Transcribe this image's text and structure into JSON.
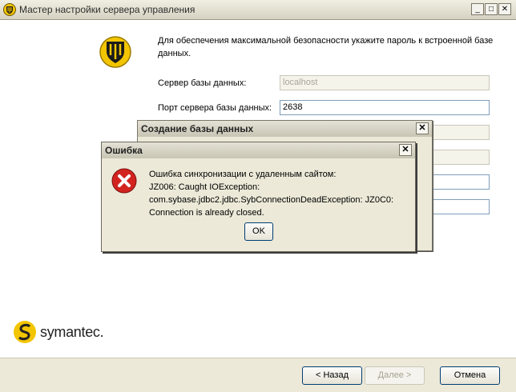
{
  "main_window": {
    "title": "Мастер настройки сервера управления",
    "controls": {
      "minimize": "_",
      "maximize": "□",
      "close": "✕"
    },
    "intro": "Для обеспечения максимальной безопасности укажите пароль к встроенной базе данных.",
    "fields": [
      {
        "label": "Сервер базы данных:",
        "value": "localhost",
        "disabled": true
      },
      {
        "label": "Порт сервера базы данных:",
        "value": "2638",
        "disabled": false
      }
    ],
    "brand": "symantec.",
    "buttons": {
      "back": "< Назад",
      "next": "Далее >",
      "cancel": "Отмена"
    }
  },
  "db_dialog": {
    "title": "Создание базы данных",
    "close": "✕"
  },
  "error_dialog": {
    "title": "Ошибка",
    "close": "✕",
    "message_lines": [
      "Ошибка синхронизации с удаленным сайтом:",
      "JZ006: Caught IOException:",
      "com.sybase.jdbc2.jdbc.SybConnectionDeadException: JZ0C0:",
      "Connection is already closed."
    ],
    "ok": "OK"
  },
  "colors": {
    "accent_yellow": "#f2c500",
    "error_red": "#d2231f",
    "titlebar": "#d6d2c2"
  }
}
